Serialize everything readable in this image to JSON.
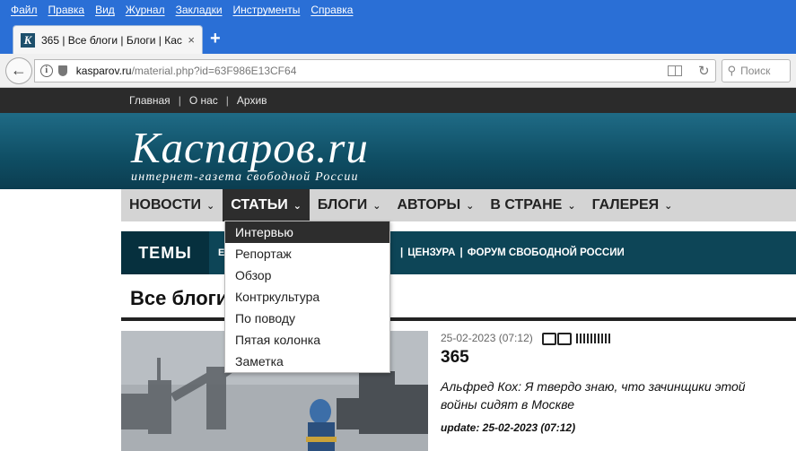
{
  "menubar": [
    "Файл",
    "Правка",
    "Вид",
    "Журнал",
    "Закладки",
    "Инструменты",
    "Справка"
  ],
  "tab": {
    "favicon": "K",
    "title": "365 | Все блоги | Блоги | Кас...",
    "close": "×",
    "new": "+"
  },
  "nav": {
    "url_host": "kasparov.ru",
    "url_rest": "/material.php?id=63F986E13CF64",
    "search_placeholder": "Поиск"
  },
  "site": {
    "toplinks": [
      "Главная",
      "О нас",
      "Архив"
    ],
    "toplink_sep": "|",
    "logo": "Каспаров.ru",
    "slogan": "интернет-газета свободной России",
    "mainnav": [
      "НОВОСТИ",
      "СТАТЬИ",
      "БЛОГИ",
      "АВТОРЫ",
      "В СТРАНЕ",
      "ГАЛЕРЕЯ"
    ],
    "chevron": "⌄",
    "themes_label": "ТЕМЫ",
    "themes_partial": "Е",
    "themes_links": [
      "ЦЕНЗУРА",
      "ФОРУМ СВОБОДНОЙ РОССИИ"
    ],
    "section_title": "Все блоги",
    "dropdown": [
      "Интервью",
      "Репортаж",
      "Обзор",
      "Контркультура",
      "По поводу",
      "Пятая колонка",
      "Заметка"
    ]
  },
  "article": {
    "date": "25-02-2023 (07:12)",
    "title": "365",
    "lead": "Альфред Кох: Я твердо знаю, что зачинщики этой войны сидят в Москве",
    "update": "update: 25-02-2023 (07:12)"
  },
  "colors": {
    "menubar": "#2a6fd6",
    "header": "#0f4e64",
    "themes": "#0d4557",
    "nav_active": "#2d2d2d"
  }
}
